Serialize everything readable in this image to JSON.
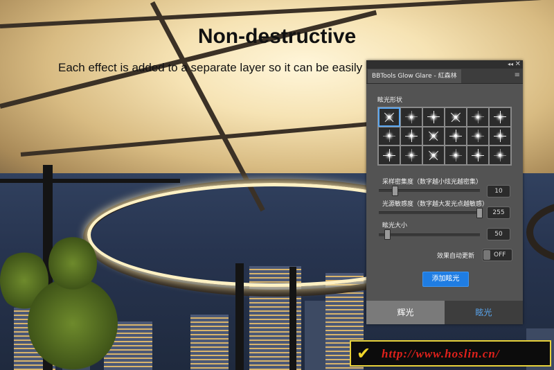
{
  "heading": "Non-destructive",
  "subtitle": "Each effect is added to a separate layer so it can be easily",
  "panel": {
    "tab_title": "BBTools Glow Glare - 紅森林",
    "shape_label": "眩光形状",
    "sliders": [
      {
        "label": "采样密集度（数字越小炫光越密集）",
        "value": "10",
        "fraction": 0.08
      },
      {
        "label": "光源敏感度（数字越大发光点越敏感）",
        "value": "255",
        "fraction": 1.0
      },
      {
        "label": "眩光大小",
        "value": "50",
        "fraction": 0.0
      }
    ],
    "auto_update_label": "效果自动更新",
    "toggle_text": "OFF",
    "add_button": "添加眩光",
    "bottom_tabs": [
      "辉光",
      "眩光"
    ]
  },
  "watermark": "http://www.hoslin.cn/",
  "colors": {
    "accent_blue": "#1f7de3",
    "panel_bg": "#535353",
    "watermark_text": "#e0211b",
    "watermark_border": "#e8d23a"
  }
}
